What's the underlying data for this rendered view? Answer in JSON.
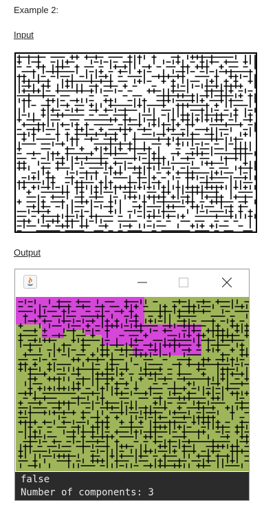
{
  "heading": "Example 2:",
  "input_label": "Input",
  "output_label": "Output",
  "colors": {
    "maze_wall": "#000000",
    "component_1": "#9eb55a",
    "component_2": "#d447d8",
    "console_bg": "#2b2b2b",
    "console_text": "#e9e9e9"
  },
  "window": {
    "icon": "java-icon",
    "controls": [
      "minimize-icon",
      "maximize-icon",
      "close-icon"
    ]
  },
  "console": {
    "line1": "false",
    "line2": "Number of components: 3"
  }
}
